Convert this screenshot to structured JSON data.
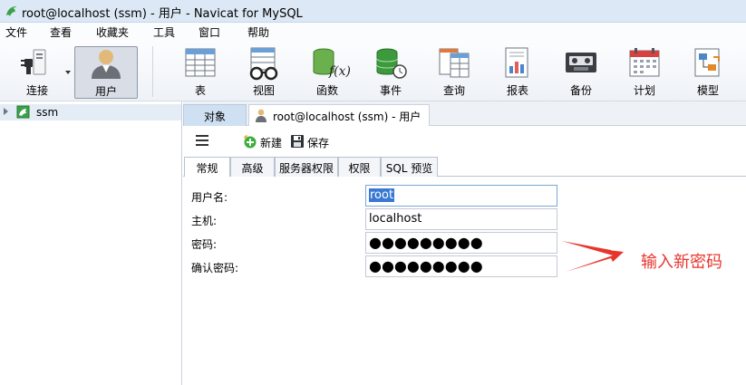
{
  "window": {
    "title": "root@localhost (ssm) - 用户 - Navicat for MySQL"
  },
  "menubar": {
    "items": [
      "文件",
      "查看",
      "收藏夹",
      "工具",
      "窗口",
      "帮助"
    ]
  },
  "toolbar": {
    "buttons": [
      {
        "label": "连接",
        "icon": "plug-icon"
      },
      {
        "label": "用户",
        "icon": "user-icon",
        "active": true
      },
      {
        "label": "表",
        "icon": "table-icon"
      },
      {
        "label": "视图",
        "icon": "view-glasses-icon"
      },
      {
        "label": "函数",
        "icon": "function-icon"
      },
      {
        "label": "事件",
        "icon": "event-database-clock-icon"
      },
      {
        "label": "查询",
        "icon": "query-icon"
      },
      {
        "label": "报表",
        "icon": "report-icon"
      },
      {
        "label": "备份",
        "icon": "backup-tape-icon"
      },
      {
        "label": "计划",
        "icon": "calendar-icon"
      },
      {
        "label": "模型",
        "icon": "model-icon"
      }
    ]
  },
  "tree": {
    "items": [
      {
        "label": "ssm",
        "icon": "database-icon"
      }
    ]
  },
  "doc_tabs": {
    "objects": "对象",
    "user_tab": "root@localhost (ssm) - 用户"
  },
  "subtoolbar": {
    "new_label": "新建",
    "save_label": "保存"
  },
  "inner_tabs": [
    "常规",
    "高级",
    "服务器权限",
    "权限",
    "SQL 预览"
  ],
  "form": {
    "username_label": "用户名:",
    "username_value": "root",
    "host_label": "主机:",
    "host_value": "localhost",
    "password_label": "密码:",
    "password_value": "●●●●●●●●●",
    "confirm_label": "确认密码:",
    "confirm_value": "●●●●●●●●●"
  },
  "annotation": {
    "text": "输入新密码",
    "color": "#e8352c"
  },
  "colors": {
    "titlebar": "#dce8f5",
    "active_tab": "#cfe0f2",
    "selection": "#3a78d4"
  }
}
